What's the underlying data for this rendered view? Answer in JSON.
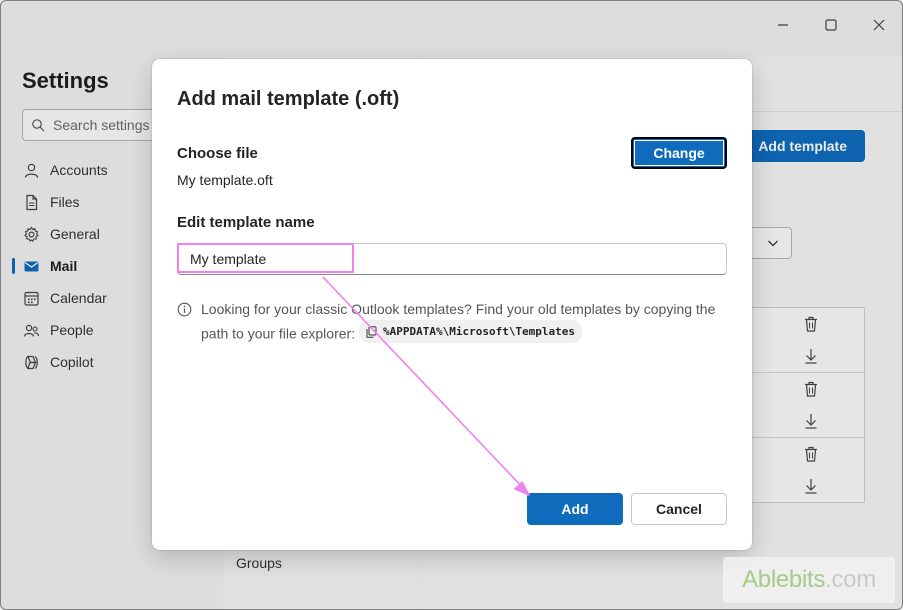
{
  "settings": {
    "title": "Settings",
    "search_placeholder": "Search settings",
    "nav": [
      {
        "label": "Accounts",
        "icon": "person-icon"
      },
      {
        "label": "Files",
        "icon": "file-icon"
      },
      {
        "label": "General",
        "icon": "gear-icon"
      },
      {
        "label": "Mail",
        "icon": "mail-icon",
        "active": true
      },
      {
        "label": "Calendar",
        "icon": "calendar-icon"
      },
      {
        "label": "People",
        "icon": "people-icon"
      },
      {
        "label": "Copilot",
        "icon": "copilot-icon"
      }
    ],
    "groups_label": "Groups"
  },
  "background": {
    "add_template_label": "Add template"
  },
  "dialog": {
    "title": "Add mail template (.oft)",
    "choose_file_label": "Choose file",
    "file_name": "My template.oft",
    "change_label": "Change",
    "edit_name_label": "Edit template name",
    "template_name_value": "My template",
    "info_text": "Looking for your classic Outlook templates? Find your old templates by copying the path to your file explorer:",
    "path_text": "%APPDATA%\\Microsoft\\Templates",
    "add_label": "Add",
    "cancel_label": "Cancel"
  },
  "watermark": {
    "brand": "Ablebits",
    "suffix": ".com"
  },
  "colors": {
    "accent": "#0f6cbd",
    "annotation": "#ee82ee"
  }
}
